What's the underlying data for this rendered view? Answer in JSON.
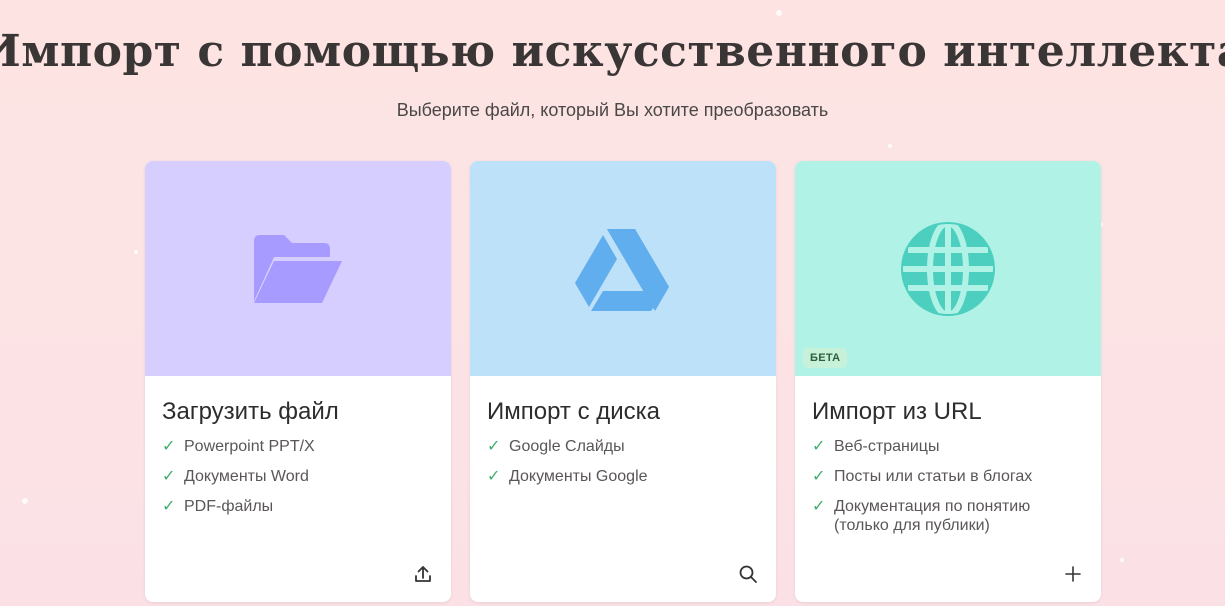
{
  "header": {
    "title": "Импорт с помощью искусственного интеллекта",
    "icon": "import-file-icon",
    "subtitle": "Выберите файл, который Вы хотите преобразовать"
  },
  "cards": [
    {
      "title": "Загрузить файл",
      "icon": "folder-icon",
      "action_icon": "upload-icon",
      "colors": {
        "top": "#d6ceff",
        "icon": "#a79bff"
      },
      "features": [
        "Powerpoint PPT/X",
        "Документы Word",
        "PDF-файлы"
      ]
    },
    {
      "title": "Импорт с диска",
      "icon": "google-drive-icon",
      "action_icon": "search-icon",
      "colors": {
        "top": "#bde1f8",
        "icon": "#61aeee"
      },
      "features": [
        "Google Слайды",
        "Документы Google"
      ]
    },
    {
      "title": "Импорт из URL",
      "icon": "globe-icon",
      "action_icon": "plus-icon",
      "badge": "БЕТА",
      "colors": {
        "top": "#b0f3e6",
        "icon": "#4ccfbf"
      },
      "features": [
        "Веб-страницы",
        "Посты или статьи в блогах",
        "Документация по понятию\n(только для публики)"
      ]
    }
  ],
  "colors": {
    "check": "#3fae6a",
    "accent": "#c98bf5"
  }
}
